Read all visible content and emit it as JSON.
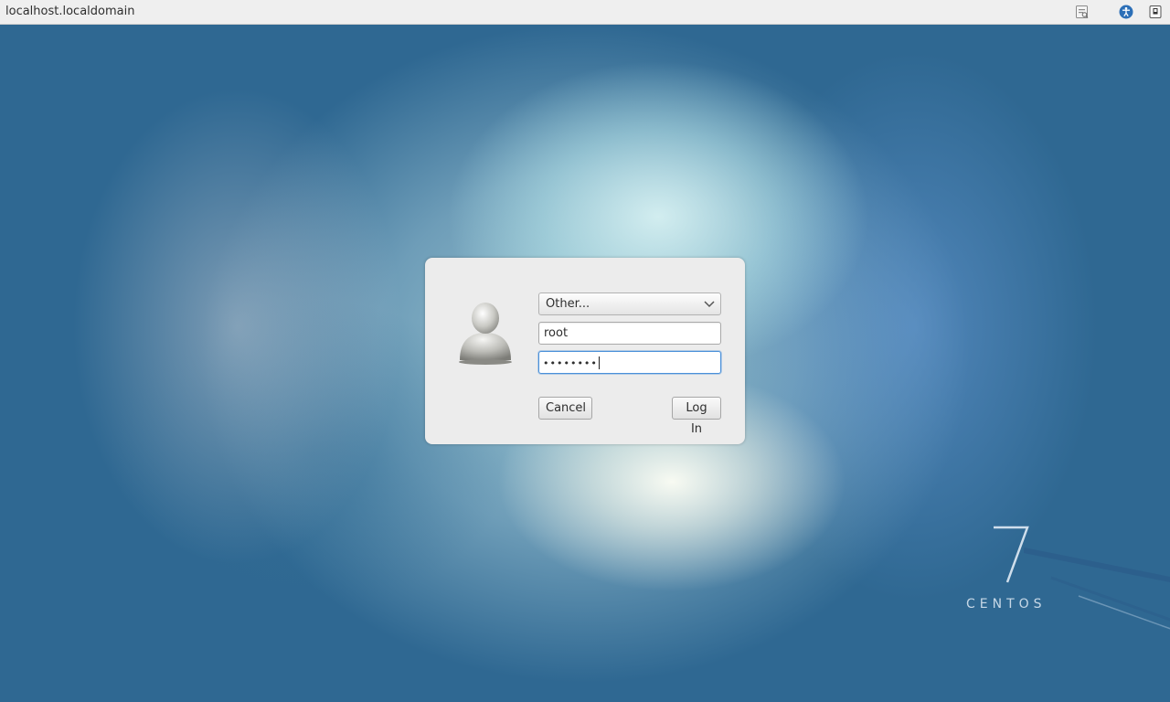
{
  "panel": {
    "hostname": "localhost.localdomain",
    "icons": [
      "keyboard-layout-icon",
      "accessibility-icon",
      "power-icon"
    ]
  },
  "login_dialog": {
    "user_select": {
      "selected": "Other..."
    },
    "username": {
      "value": "root"
    },
    "password": {
      "masked_value": "••••••••"
    },
    "cancel_label": "Cancel",
    "login_label": "Log In"
  },
  "branding": {
    "version": "7",
    "name": "CENTOS"
  },
  "colors": {
    "focus_border": "#4a90d9",
    "dialog_bg": "#ececec",
    "panel_bg": "#efefef"
  }
}
